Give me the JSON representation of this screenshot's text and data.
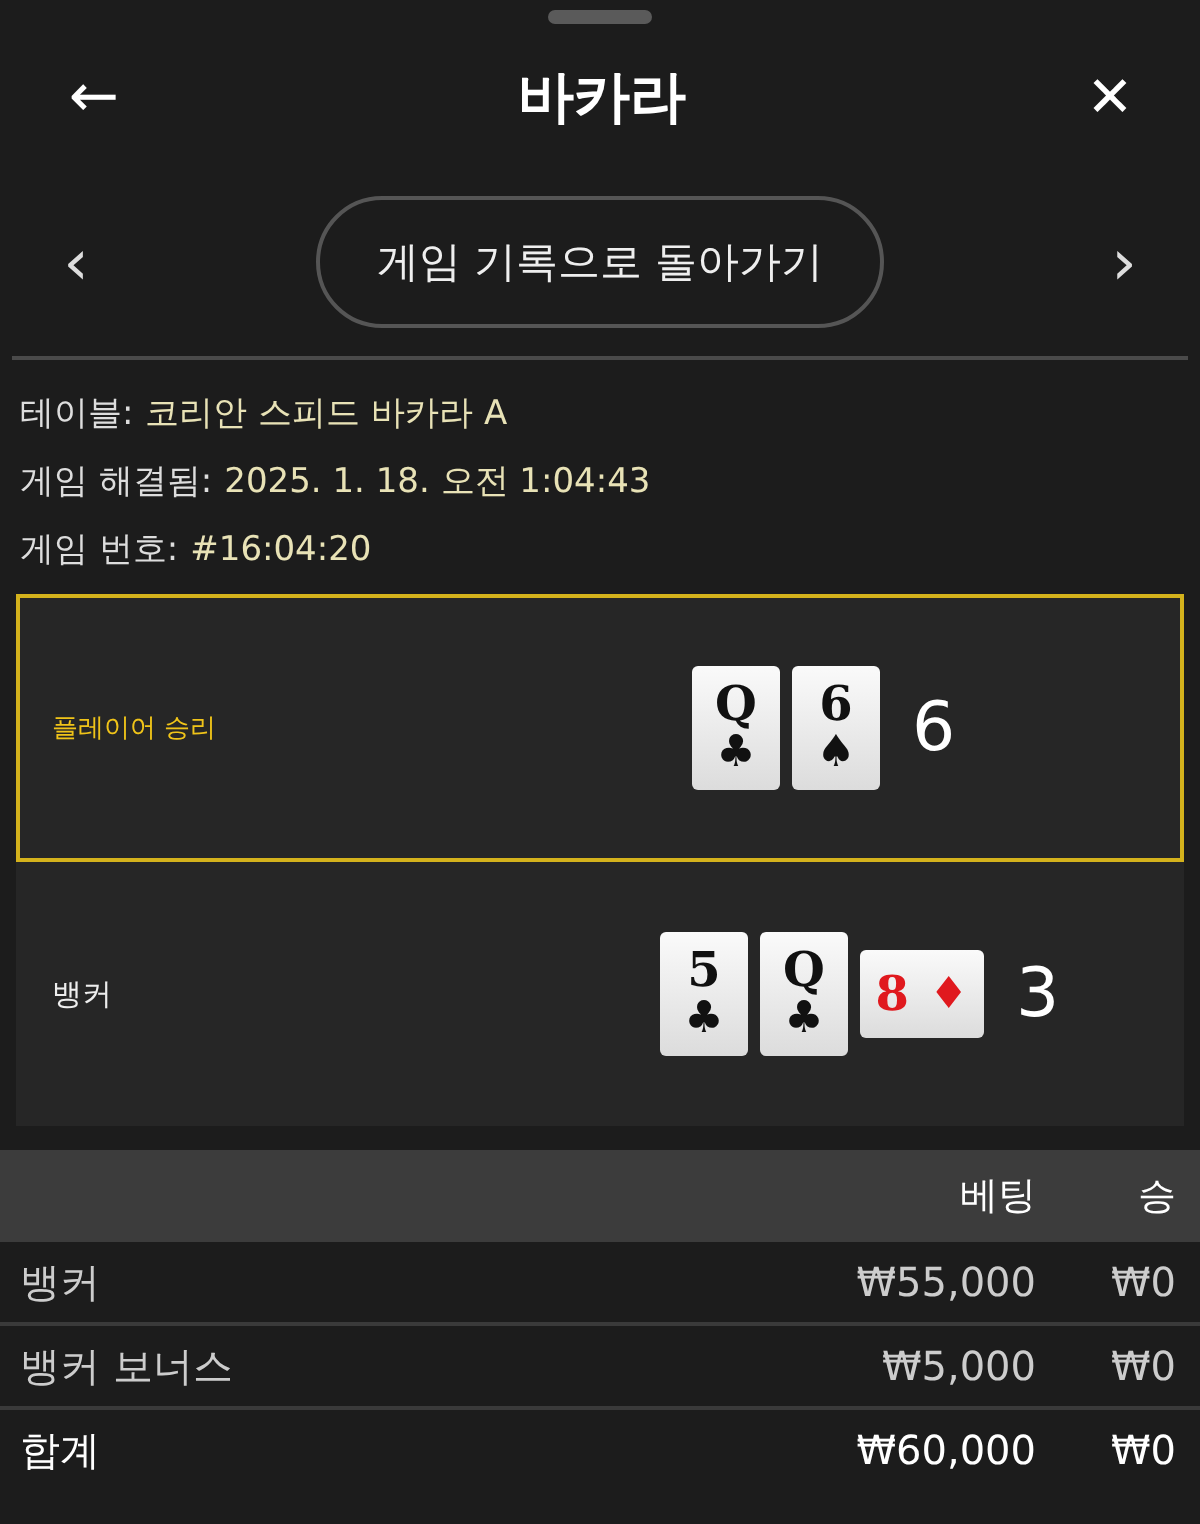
{
  "header": {
    "back": "←",
    "title": "바카라",
    "close": "✕"
  },
  "nav": {
    "prev": "‹",
    "button": "게임 기록으로 돌아가기",
    "next": "›"
  },
  "info": [
    {
      "label": "테이블:",
      "value": "코리안 스피드 바카라 A"
    },
    {
      "label": "게임 해결됨:",
      "value": "2025. 1. 18. 오전 1:04:43"
    },
    {
      "label": "게임 번호:",
      "value": "#16:04:20"
    }
  ],
  "hands": [
    {
      "name": "플레이어 승리",
      "winner": true,
      "score": "6",
      "cards": [
        {
          "rank": "Q",
          "suit": "♣",
          "red": false,
          "sideways": false
        },
        {
          "rank": "6",
          "suit": "♠",
          "red": false,
          "sideways": false
        }
      ]
    },
    {
      "name": "뱅커",
      "winner": false,
      "score": "3",
      "cards": [
        {
          "rank": "5",
          "suit": "♣",
          "red": false,
          "sideways": false
        },
        {
          "rank": "Q",
          "suit": "♣",
          "red": false,
          "sideways": false
        },
        {
          "rank": "8",
          "suit": "♦",
          "red": true,
          "sideways": true
        }
      ]
    }
  ],
  "table": {
    "columns": [
      "베팅",
      "승"
    ],
    "rows": [
      {
        "name": "뱅커",
        "bet": "₩55,000",
        "win": "₩0",
        "total": false
      },
      {
        "name": "뱅커 보너스",
        "bet": "₩5,000",
        "win": "₩0",
        "total": false
      },
      {
        "name": "합계",
        "bet": "₩60,000",
        "win": "₩0",
        "total": true
      }
    ]
  }
}
